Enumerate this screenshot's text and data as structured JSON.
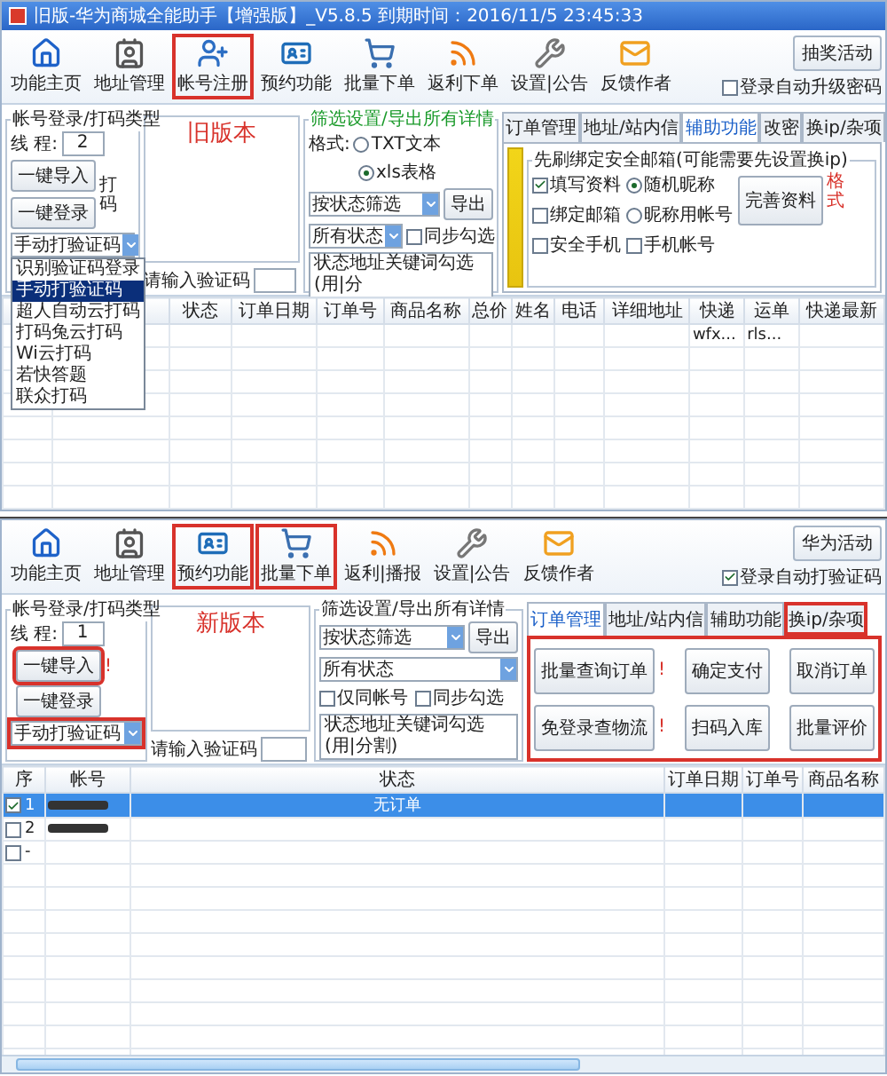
{
  "old_version": {
    "title": "旧版-华为商城全能助手【增强版】_V5.8.5 到期时间：2016/11/5 23:45:33",
    "toolbar": [
      {
        "label": "功能主页",
        "highlighted": false
      },
      {
        "label": "地址管理",
        "highlighted": false
      },
      {
        "label": "帐号注册",
        "highlighted": true
      },
      {
        "label": "预约功能",
        "highlighted": false
      },
      {
        "label": "批量下单",
        "highlighted": false
      },
      {
        "label": "返利下单",
        "highlighted": false
      },
      {
        "label": "设置|公告",
        "highlighted": false
      },
      {
        "label": "反馈作者",
        "highlighted": false
      }
    ],
    "auto_option": {
      "label": "登录自动升级密码",
      "checked": false
    },
    "promo_button": "抽奖活动",
    "login_group": {
      "title": "帐号登录/打码类型",
      "thread_label": "线 程:",
      "thread_value": "2",
      "import_button": "一键导入",
      "login_button": "一键登录",
      "side_label": "打码",
      "captcha_select": {
        "value": "手动打验证码",
        "expanded": true,
        "options": [
          {
            "label": "识别验证码登录",
            "selected": false
          },
          {
            "label": "手动打验证码",
            "selected": true
          },
          {
            "label": "超人自动云打码",
            "selected": false
          },
          {
            "label": "打码兔云打码",
            "selected": false
          },
          {
            "label": "Wi云打码",
            "selected": false
          },
          {
            "label": "若快答题",
            "selected": false
          },
          {
            "label": "联众打码",
            "selected": false
          }
        ]
      }
    },
    "version_label": "旧版本",
    "captcha_label": "请输入验证码",
    "filter_group": {
      "title": "筛选设置/导出所有详情",
      "format_label": "格式:",
      "formats": [
        {
          "label": "TXT文本",
          "selected": false
        },
        {
          "label": "xls表格",
          "selected": true
        }
      ],
      "selects": [
        "按状态筛选",
        "所有状态"
      ],
      "sync_check": {
        "label": "同步勾选",
        "checked": false
      },
      "export_button": "导出",
      "keyword_field": "状态地址关键词勾选(用|分"
    },
    "tabs": [
      {
        "label": "订单管理",
        "selected": false
      },
      {
        "label": "地址/站内信",
        "selected": false
      },
      {
        "label": "辅助功能",
        "selected": true
      },
      {
        "label": "改密",
        "selected": false
      },
      {
        "label": "换ip/杂项",
        "selected": false
      }
    ],
    "assist_panel": {
      "title": "先刷绑定安全邮箱(可能需要先设置换ip)",
      "options": [
        {
          "kind": "checkbox",
          "label": "填写资料",
          "checked": true
        },
        {
          "kind": "radio",
          "label": "随机昵称",
          "checked": true
        },
        {
          "kind": "checkbox",
          "label": "绑定邮箱",
          "checked": false
        },
        {
          "kind": "radio",
          "label": "昵称用帐号",
          "checked": false
        },
        {
          "kind": "checkbox",
          "label": "安全手机",
          "checked": false
        },
        {
          "kind": "checkbox",
          "label": "手机帐号",
          "checked": false
        }
      ],
      "button": "完善资料",
      "note": "格式"
    },
    "table": {
      "columns": [
        {
          "label": "状态"
        },
        {
          "label": "订单日期"
        },
        {
          "label": "订单号"
        },
        {
          "label": "商品名称"
        },
        {
          "label": "总价"
        },
        {
          "label": "姓名"
        },
        {
          "label": "电话"
        },
        {
          "label": "详细地址"
        },
        {
          "label": "快递",
          "cells": [
            "wfx..."
          ]
        },
        {
          "label": "运单",
          "cells": [
            "rls..."
          ]
        },
        {
          "label": "快递最新"
        }
      ]
    }
  },
  "new_version": {
    "toolbar": [
      {
        "label": "功能主页",
        "highlighted": false
      },
      {
        "label": "地址管理",
        "highlighted": false
      },
      {
        "label": "预约功能",
        "highlighted": true
      },
      {
        "label": "批量下单",
        "highlighted": true
      },
      {
        "label": "返利|播报",
        "highlighted": false
      },
      {
        "label": "设置|公告",
        "highlighted": false
      },
      {
        "label": "反馈作者",
        "highlighted": false
      }
    ],
    "auto_option": {
      "label": "登录自动打验证码",
      "checked": true
    },
    "promo_button": "华为活动",
    "login_group": {
      "title": "帐号登录/打码类型",
      "thread_label": "线 程:",
      "thread_value": "1",
      "import_button": {
        "label": "一键导入",
        "highlighted": true
      },
      "alert": "!",
      "login_button": "一键登录",
      "captcha_select": {
        "value": "手动打验证码",
        "highlighted": true
      }
    },
    "version_label": "新版本",
    "captcha_label": "请输入验证码",
    "filter_group": {
      "title": "筛选设置/导出所有详情",
      "selects": [
        "按状态筛选",
        "所有状态"
      ],
      "export_button": "导出",
      "checks": [
        {
          "label": "仅同帐号",
          "checked": false
        },
        {
          "label": "同步勾选",
          "checked": false
        }
      ],
      "keyword_field": "状态地址关键词勾选(用|分割)"
    },
    "tabs": [
      {
        "label": "订单管理",
        "selected": true,
        "highlighted": false
      },
      {
        "label": "地址/站内信",
        "selected": false,
        "highlighted": false
      },
      {
        "label": "辅助功能",
        "selected": false,
        "highlighted": false
      },
      {
        "label": "换ip/杂项",
        "selected": false,
        "highlighted": true
      }
    ],
    "order_panel": {
      "highlighted": true,
      "buttons": [
        {
          "label": "批量查询订单",
          "alert": "!"
        },
        {
          "label": "确定支付"
        },
        {
          "label": "取消订单"
        },
        {
          "label": "免登录查物流",
          "alert": "!"
        },
        {
          "label": "扫码入库"
        },
        {
          "label": "批量评价"
        }
      ]
    },
    "table": {
      "columns": [
        "序",
        "帐号",
        "状态",
        "订单日期",
        "订单号",
        "商品名称"
      ],
      "rows": [
        {
          "checked": true,
          "selected": true,
          "number": "1",
          "redacted": true,
          "status": "无订单"
        },
        {
          "checked": false,
          "selected": false,
          "number": "2",
          "redacted": true
        },
        {
          "checked": false,
          "selected": false,
          "number": "-",
          "redacted": false
        }
      ]
    }
  }
}
